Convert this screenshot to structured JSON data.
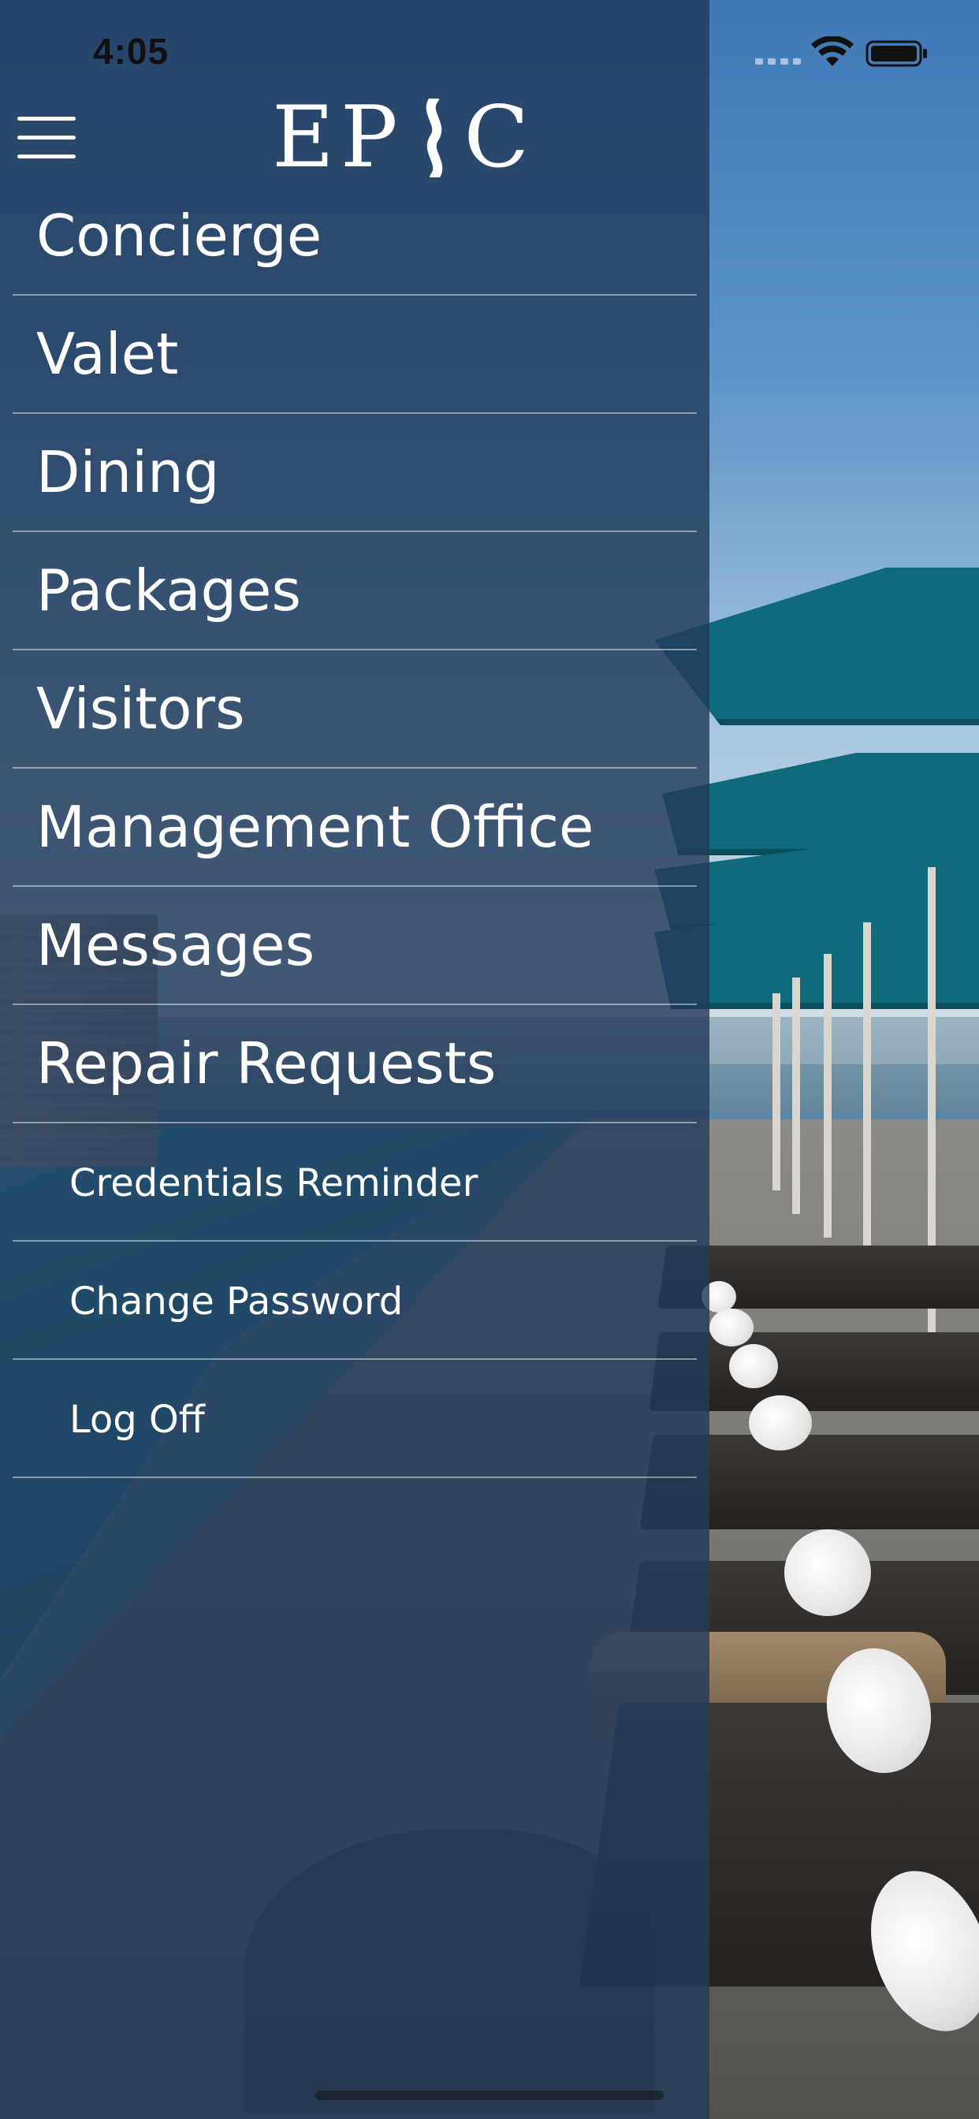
{
  "status_bar": {
    "time": "4:05"
  },
  "header": {
    "logo_text": "EP C",
    "menu_icon": "hamburger-icon"
  },
  "menu": {
    "primary": [
      {
        "label": "Concierge"
      },
      {
        "label": "Valet"
      },
      {
        "label": "Dining"
      },
      {
        "label": "Packages"
      },
      {
        "label": "Visitors"
      },
      {
        "label": "Management Office"
      },
      {
        "label": "Messages"
      },
      {
        "label": "Repair Requests"
      }
    ],
    "secondary": [
      {
        "label": "Credentials Reminder"
      },
      {
        "label": "Change Password"
      },
      {
        "label": "Log Off"
      }
    ]
  },
  "colors": {
    "drawer_overlay": "#223a5a",
    "menu_text": "#ffffff",
    "umbrella": "#0f6b7c",
    "sky": "#3f79b6"
  }
}
